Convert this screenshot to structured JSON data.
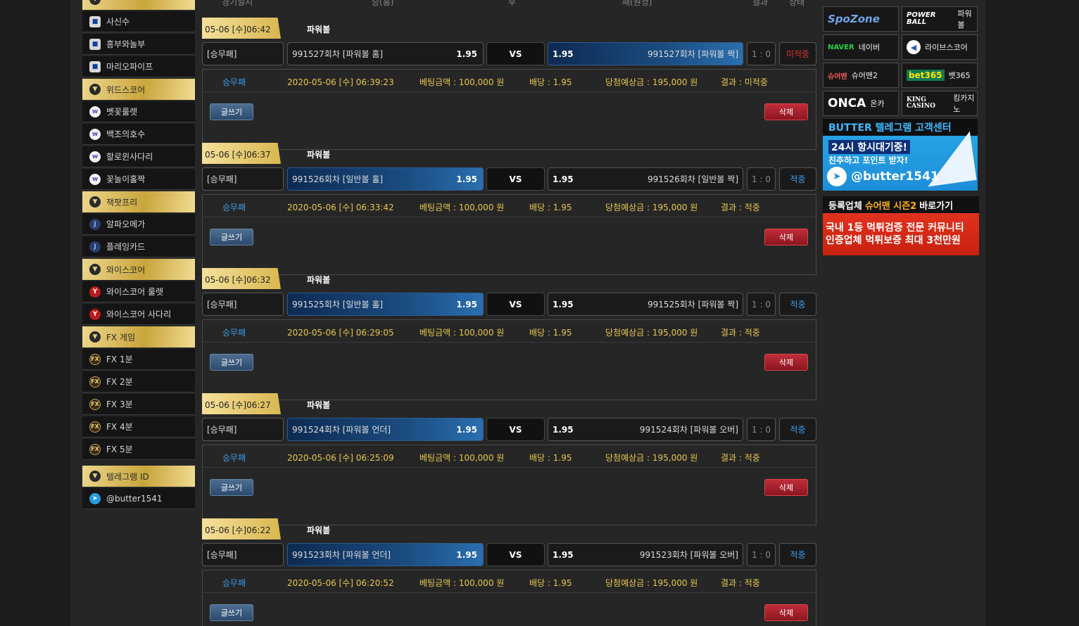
{
  "sidebar": {
    "groups": [
      {
        "title": "",
        "items": [
          {
            "label": "사신수",
            "icon": "square"
          },
          {
            "label": "흥부와놀부",
            "icon": "square"
          },
          {
            "label": "마리오파이프",
            "icon": "square"
          }
        ]
      },
      {
        "title": "위드스코어",
        "items": [
          {
            "label": "벳꽃룰렛",
            "icon": "circle"
          },
          {
            "label": "백조의호수",
            "icon": "circle"
          },
          {
            "label": "할로윈사다리",
            "icon": "circle"
          },
          {
            "label": "꽃놀이홀짝",
            "icon": "circle"
          }
        ]
      },
      {
        "title": "잭팟프리",
        "items": [
          {
            "label": "알파오메가",
            "icon": "alpha"
          },
          {
            "label": "플레잉카드",
            "icon": "alpha"
          }
        ]
      },
      {
        "title": "와이스코어",
        "items": [
          {
            "label": "와이스코어 룰렛",
            "icon": "wise"
          },
          {
            "label": "와이스코어 사다리",
            "icon": "wise"
          }
        ]
      },
      {
        "title": "FX 게임",
        "items": [
          {
            "label": "FX 1분",
            "icon": "fx"
          },
          {
            "label": "FX 2분",
            "icon": "fx"
          },
          {
            "label": "FX 3분",
            "icon": "fx"
          },
          {
            "label": "FX 4분",
            "icon": "fx"
          },
          {
            "label": "FX 5분",
            "icon": "fx"
          }
        ]
      }
    ],
    "telegram": {
      "title": "텔레그램 ID",
      "handle": "@butter1541"
    }
  },
  "table_header": {
    "date": "경기일시",
    "home": "승(홈)",
    "draw": "무",
    "away": "패(원정)",
    "result": "결과",
    "status": "상태"
  },
  "bets": [
    {
      "date": "05-06 [수]06:42",
      "game": "파워볼",
      "type": "[승무패]",
      "home": "991527회차 [파워볼 홈]",
      "home_odds": "1.95",
      "vs": "VS",
      "away_odds": "1.95",
      "away": "991527회차 [파워볼 짝]",
      "selected": "away",
      "score": "1 : 0",
      "status": "미적중",
      "detail": {
        "type": "승무패",
        "time": "2020-05-06 [수] 06:39:23",
        "amount": "베팅금액 : 100,000 원",
        "odds": "배당 : 1.95",
        "expected": "당첨예상금 : 195,000 원",
        "result": "결과 : 미적중"
      }
    },
    {
      "date": "05-06 [수]06:37",
      "game": "파워볼",
      "type": "[승무패]",
      "home": "991526회차 [일반볼 홀]",
      "home_odds": "1.95",
      "vs": "VS",
      "away_odds": "1.95",
      "away": "991526회차 [일반볼 짝]",
      "selected": "home",
      "score": "1 : 0",
      "status": "적중",
      "detail": {
        "type": "승무패",
        "time": "2020-05-06 [수] 06:33:42",
        "amount": "베팅금액 : 100,000 원",
        "odds": "배당 : 1.95",
        "expected": "당첨예상금 : 195,000 원",
        "result": "결과 : 적중"
      }
    },
    {
      "date": "05-06 [수]06:32",
      "game": "파워볼",
      "type": "[승무패]",
      "home": "991525회차 [일반볼 홀]",
      "home_odds": "1.95",
      "vs": "VS",
      "away_odds": "1.95",
      "away": "991525회차 [파워볼 짝]",
      "selected": "home",
      "score": "1 : 0",
      "status": "적중",
      "detail": {
        "type": "승무패",
        "time": "2020-05-06 [수] 06:29:05",
        "amount": "베팅금액 : 100,000 원",
        "odds": "배당 : 1.95",
        "expected": "당첨예상금 : 195,000 원",
        "result": "결과 : 적중"
      }
    },
    {
      "date": "05-06 [수]06:27",
      "game": "파워볼",
      "type": "[승무패]",
      "home": "991524회차 [파워볼 언더]",
      "home_odds": "1.95",
      "vs": "VS",
      "away_odds": "1.95",
      "away": "991524회차 [파워볼 오버]",
      "selected": "home",
      "score": "1 : 0",
      "status": "적중",
      "detail": {
        "type": "승무패",
        "time": "2020-05-06 [수] 06:25:09",
        "amount": "베팅금액 : 100,000 원",
        "odds": "배당 : 1.95",
        "expected": "당첨예상금 : 195,000 원",
        "result": "결과 : 적중"
      }
    },
    {
      "date": "05-06 [수]06:22",
      "game": "파워볼",
      "type": "[승무패]",
      "home": "991523회차 [파워볼 언더]",
      "home_odds": "1.95",
      "vs": "VS",
      "away_odds": "1.95",
      "away": "991523회차 [파워볼 오버]",
      "selected": "home",
      "score": "1 : 0",
      "status": "적중",
      "detail": {
        "type": "승무패",
        "time": "2020-05-06 [수] 06:20:52",
        "amount": "베팅금액 : 100,000 원",
        "odds": "배당 : 1.95",
        "expected": "당첨예상금 : 195,000 원",
        "result": "결과 : 적중"
      }
    }
  ],
  "buttons": {
    "write": "글쓰기",
    "delete": "삭제"
  },
  "sites": [
    {
      "logo": "SpoZone",
      "label": "",
      "style": "spo"
    },
    {
      "logo": "POWER BALL",
      "label": "파워볼",
      "style": "pb"
    },
    {
      "logo": "NAVER",
      "label": "네이버",
      "style": "naver"
    },
    {
      "logo": "◀",
      "label": "라이브스코어",
      "style": "live"
    },
    {
      "logo": "슈어맨",
      "label": "슈어맨2",
      "style": "sure"
    },
    {
      "logo": "bet365",
      "label": "뱃365",
      "style": "bet"
    },
    {
      "logo": "ONCA",
      "label": "온카",
      "style": "onca"
    },
    {
      "logo": "KING CASINO",
      "label": "킹카지노",
      "style": "king"
    }
  ],
  "banner_telegram": {
    "title": "BUTTER 텔레그램 고객센터",
    "line1": "24시 항시대기중!",
    "line2": "친추하고 포인트 받자!",
    "handle": "@butter1541"
  },
  "banner_sureman": {
    "title_pre": "등록업체",
    "title_em": "슈어맨 시즌2",
    "title_post": "바로가기",
    "line1": "국내 1등 먹튀검증 전문 커뮤니티",
    "line2": "인증업체 먹튀보증 최대 3천만원"
  },
  "colors": {
    "gold": "#e8cf7b",
    "win": "#3d9ce8",
    "lose": "#e03030",
    "selected": "#1b4c80"
  }
}
